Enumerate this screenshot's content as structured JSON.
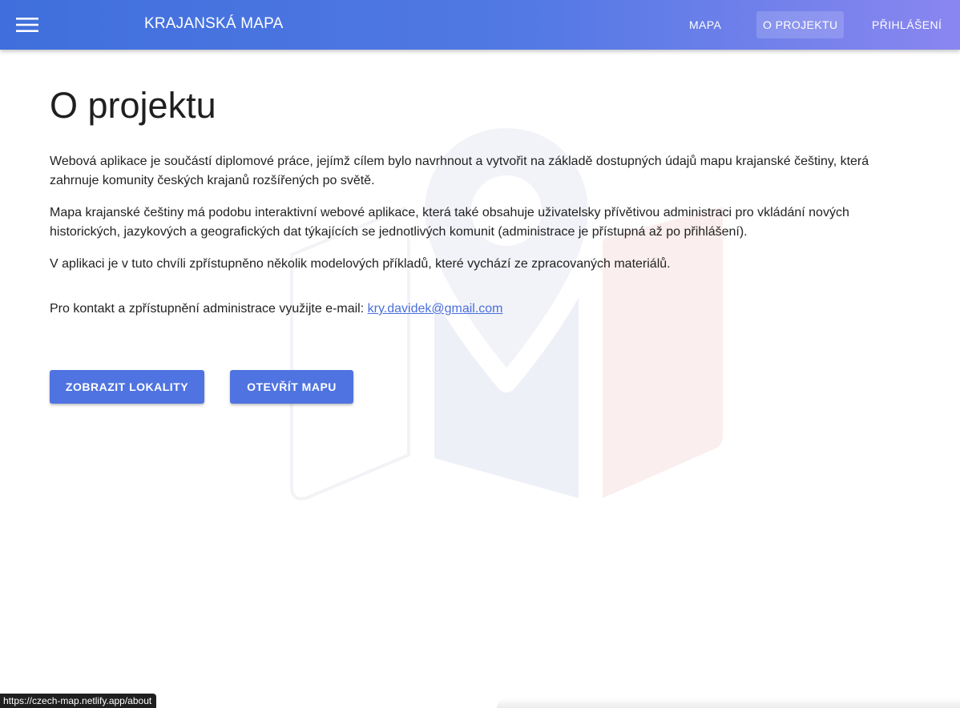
{
  "header": {
    "app_title": "KRAJANSKÁ MAPA",
    "nav": {
      "map": "MAPA",
      "about": "O PROJEKTU",
      "login": "PŘIHLÁŠENÍ"
    },
    "active_nav": "O PROJEKTU",
    "menu_icon": "hamburger-menu-icon"
  },
  "main": {
    "title": "O projektu",
    "paragraph_1": "Webová aplikace je součástí diplomové práce, jejímž cílem bylo navrhnout a vytvořit na základě dostupných údajů mapu krajanské češtiny, která zahrnuje komunity českých krajanů rozšířených po světě.",
    "paragraph_2": "Mapa krajanské češtiny má podobu interaktivní webové aplikace, která také obsahuje uživatelsky přívětivou administraci pro vkládání nových historických, jazykových a geografických dat týkajících se jednotlivých komunit (administrace je přístupná až po přihlášení).",
    "paragraph_3": "V aplikaci je v tuto chvíli zpřístupněno několik modelových příkladů, které vychází ze zpracovaných materiálů.",
    "contact_text": "Pro kontakt a zpřístupnění administrace využijte e-mail: ",
    "contact_email": "kry.davidek@gmail.com",
    "buttons": {
      "show_localities": "ZOBRAZIT LOKALITY",
      "open_map": "OTEVŘÍT MAPU"
    },
    "watermark_icon": "map-pin-flag-icon"
  },
  "status_bar": {
    "url": "https://czech-map.netlify.app/about"
  },
  "colors": {
    "app_bar_start": "#3f6fdc",
    "app_bar_end": "#8a86f0",
    "primary_button": "#4f73e1",
    "link": "#4a6fdc"
  }
}
